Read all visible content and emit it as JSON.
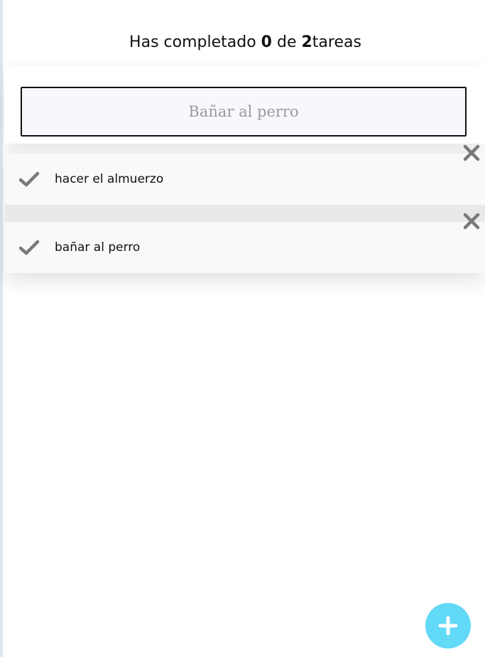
{
  "summary": {
    "prefix": "Has completado",
    "completed": "0",
    "middle": "de",
    "total": "2",
    "suffix": "tareas"
  },
  "input": {
    "placeholder": "Bañar al perro",
    "value": ""
  },
  "tasks": [
    {
      "label": "hacer el almuerzo",
      "done": false
    },
    {
      "label": "bañar al perro",
      "done": false
    }
  ],
  "icons": {
    "check": "check-icon",
    "delete": "close-icon",
    "add": "plus-icon"
  },
  "colors": {
    "fab": "#61d9f7",
    "icon": "#7a7a7a",
    "list_background": "#f9f9f9"
  }
}
